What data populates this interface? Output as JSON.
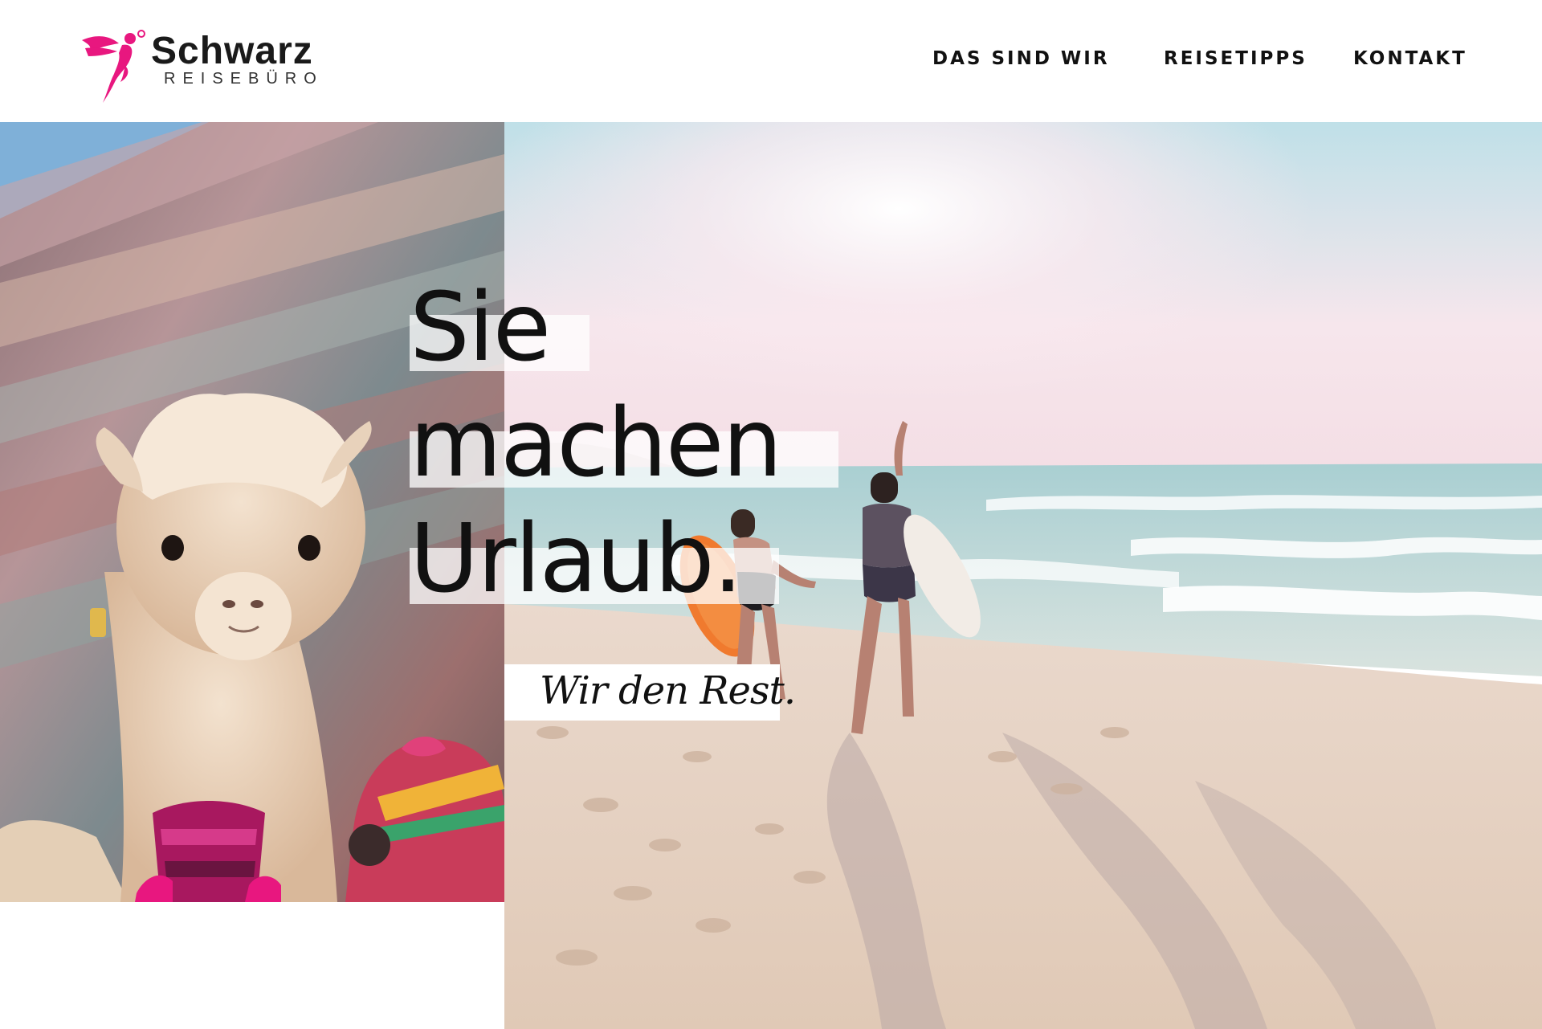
{
  "brand": {
    "name": "Schwarz",
    "subtitle": "REISEBÜRO",
    "accent_color": "#e8177f"
  },
  "nav": {
    "items": [
      "DAS SIND WIR",
      "REISETIPPS",
      "KONTAKT"
    ]
  },
  "hero": {
    "headline": [
      "Sie",
      "machen",
      "Urlaub."
    ],
    "tagline": "Wir den Rest."
  },
  "icons": {
    "logo": "angel-logo-icon"
  }
}
